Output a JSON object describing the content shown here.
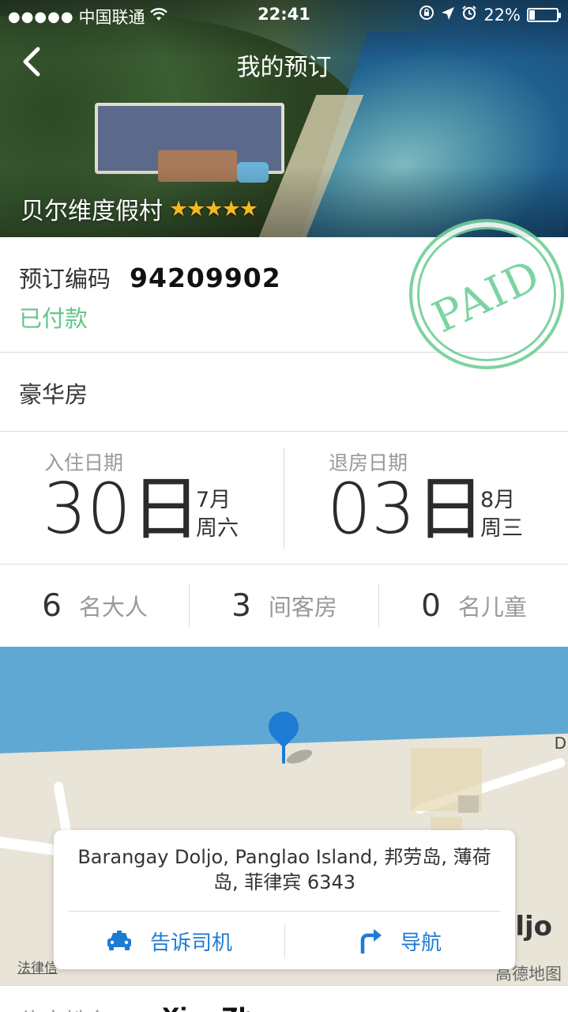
{
  "status_bar": {
    "signal": "●●●●●",
    "carrier": "中国联通",
    "time": "22:41",
    "battery": "22%",
    "battery_level": 0.22
  },
  "header": {
    "back_icon": "chevron-left-icon",
    "title": "我的预订"
  },
  "hotel": {
    "name": "贝尔维度假村",
    "stars": "★★★★★",
    "star_rating": 5,
    "star_color": "#f5b820"
  },
  "booking": {
    "code_label": "预订编码",
    "code_value": "94209902",
    "payment_status": "已付款",
    "stamp_text": "PAID",
    "status_color": "#67c48b"
  },
  "room": {
    "type": "豪华房"
  },
  "dates": {
    "check_in": {
      "label": "入住日期",
      "day": "30日",
      "month": "7月",
      "weekday": "周六"
    },
    "check_out": {
      "label": "退房日期",
      "day": "03日",
      "month": "8月",
      "weekday": "周三"
    }
  },
  "guests": {
    "adults": {
      "count": "6",
      "unit": "名大人"
    },
    "rooms": {
      "count": "3",
      "unit": "间客房"
    },
    "children": {
      "count": "0",
      "unit": "名儿童"
    }
  },
  "map": {
    "address": "Barangay Doljo, Panglao Island, 邦劳岛, 薄荷岛, 菲律宾 6343",
    "edge_label_d": "D",
    "edge_label_ljo": "ljo",
    "legal_text": "法律信",
    "provider": "高德地图",
    "tell_driver_label": "告诉司机",
    "navigate_label": "导航",
    "accent_color": "#1e7bd4"
  },
  "guest_name": {
    "label": "住客姓名",
    "value": "Xi... Zh..."
  }
}
